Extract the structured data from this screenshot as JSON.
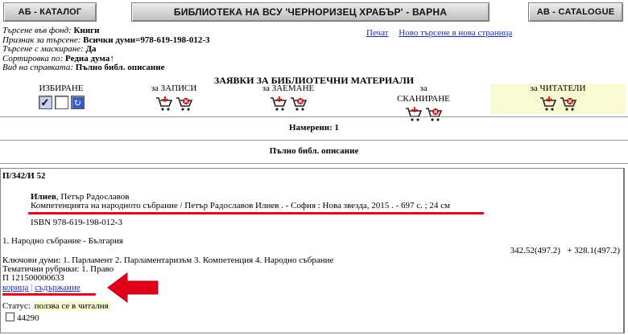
{
  "header": {
    "catalog_bg": "АБ - КАТАЛОГ",
    "banner": "БИБЛИОТЕКА НА ВСУ 'ЧЕРНОРИЗЕЦ ХРАБЪР' - ВАРНА",
    "catalog_en": "АВ - CATALOGUE"
  },
  "search_meta": [
    {
      "label": "Търсене във фонд:",
      "value": "Книги"
    },
    {
      "label": "Признак за търсене:",
      "value": "Всички думи=978-619-198-012-3"
    },
    {
      "label": "Търсене с маскиране:",
      "value": "Да"
    },
    {
      "label": "Сортировка по:",
      "value": "Редна дума↑"
    },
    {
      "label": "Вид на справката:",
      "value": "Пълно библ. описание"
    }
  ],
  "top_links": {
    "print": "Печат",
    "new_search": "Ново търсене в нова страница"
  },
  "requests": {
    "title": "ЗАЯВКИ ЗА БИБЛИОТЕЧНИ МАТЕРИАЛИ",
    "select_label": "ИЗБИРАНЕ",
    "records_label": "за ЗАПИСИ",
    "loans_label": "за ЗАЕМАНЕ",
    "scan_label": "за СКАНИРАНЕ",
    "readers_label": "за ЧИТАТЕЛИ"
  },
  "results": {
    "found": "Намерени: 1",
    "full_desc": "Пълно библ. описание"
  },
  "record": {
    "shelfmark": "П/342/И 52",
    "author_surname": "Илиев",
    "author_given": ", Петър Радославов",
    "title_line": "Компетенцията на народното събрание / Петър Радославов Илиев . - София : Нова звезда, 2015 . - 697 с. ; 24 см",
    "isbn": "ISBN 978-619-198-012-3",
    "subject": "1. Народно събрание - България",
    "udc": "342.52(497.2)   + 328.1(497.2)",
    "keywords": "Ключови думи: 1. Парламент 2. Парламентаризъм 3. Компетенция 4. Народно събрание",
    "rubrics": "Тематични рубрики: 1. Право",
    "inventory": "П 121500000633",
    "link_cover": "корица",
    "link_contents": "съдържание",
    "status_label": "Статус: ",
    "status_value": "ползва се в читалня",
    "copy_number": "44290"
  },
  "colors": {
    "link": "#1a2fa0",
    "highlight": "#fafad2",
    "annotation_red": "#e0001a",
    "cart_red": "#cc1111"
  }
}
